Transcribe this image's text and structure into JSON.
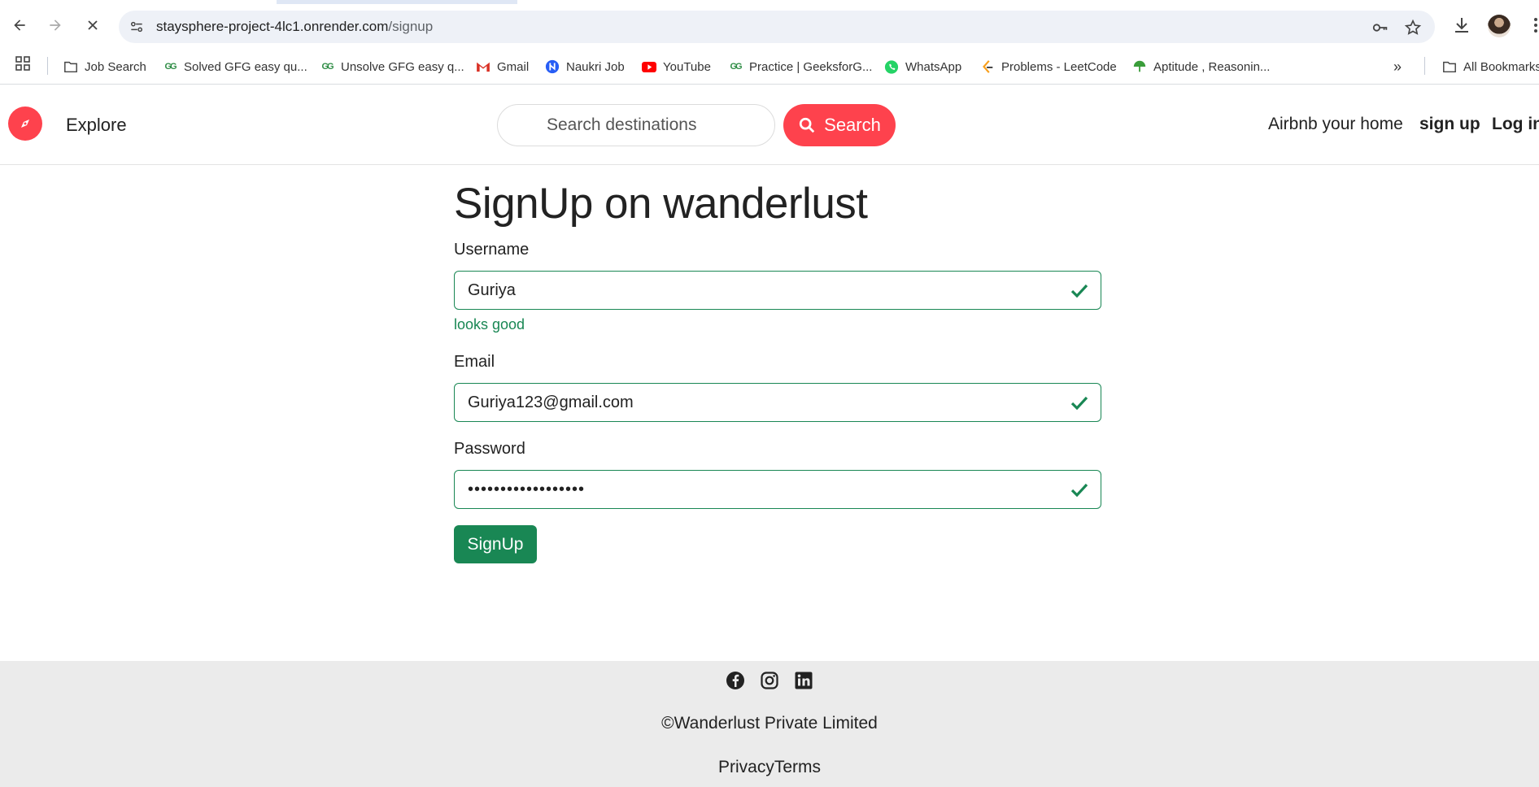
{
  "browser": {
    "url_host": "staysphere-project-4lc1.onrender.com",
    "url_path": "/signup",
    "bookmarks": [
      {
        "label": "Job Search",
        "icon": "folder-icon"
      },
      {
        "label": "Solved GFG easy qu...",
        "icon": "gfg-icon"
      },
      {
        "label": "Unsolve GFG easy q...",
        "icon": "gfg-icon"
      },
      {
        "label": "Gmail",
        "icon": "gmail-icon"
      },
      {
        "label": "Naukri Job",
        "icon": "naukri-icon"
      },
      {
        "label": "YouTube",
        "icon": "youtube-icon"
      },
      {
        "label": "Practice | GeeksforG...",
        "icon": "gfg-icon"
      },
      {
        "label": "WhatsApp",
        "icon": "whatsapp-icon"
      },
      {
        "label": "Problems - LeetCode",
        "icon": "leetcode-icon"
      },
      {
        "label": "Aptitude , Reasonin...",
        "icon": "aptitude-icon"
      }
    ],
    "all_bookmarks_label": "All Bookmarks"
  },
  "navbar": {
    "explore_label": "Explore",
    "search_placeholder": "Search destinations",
    "search_button_label": "Search",
    "airbnb_label": "Airbnb your home",
    "signup_label": "sign up",
    "login_label": "Log in"
  },
  "form": {
    "title": "SignUp on wanderlust",
    "username_label": "Username",
    "username_value": "Guriya",
    "username_feedback": "looks good",
    "email_label": "Email",
    "email_value": "Guriya123@gmail.com",
    "password_label": "Password",
    "password_value": "••••••••••••••••••",
    "submit_label": "SignUp"
  },
  "footer": {
    "copyright": "©Wanderlust Private Limited",
    "links": "PrivacyTerms"
  },
  "colors": {
    "brand": "#fe424d",
    "valid": "#198754"
  }
}
